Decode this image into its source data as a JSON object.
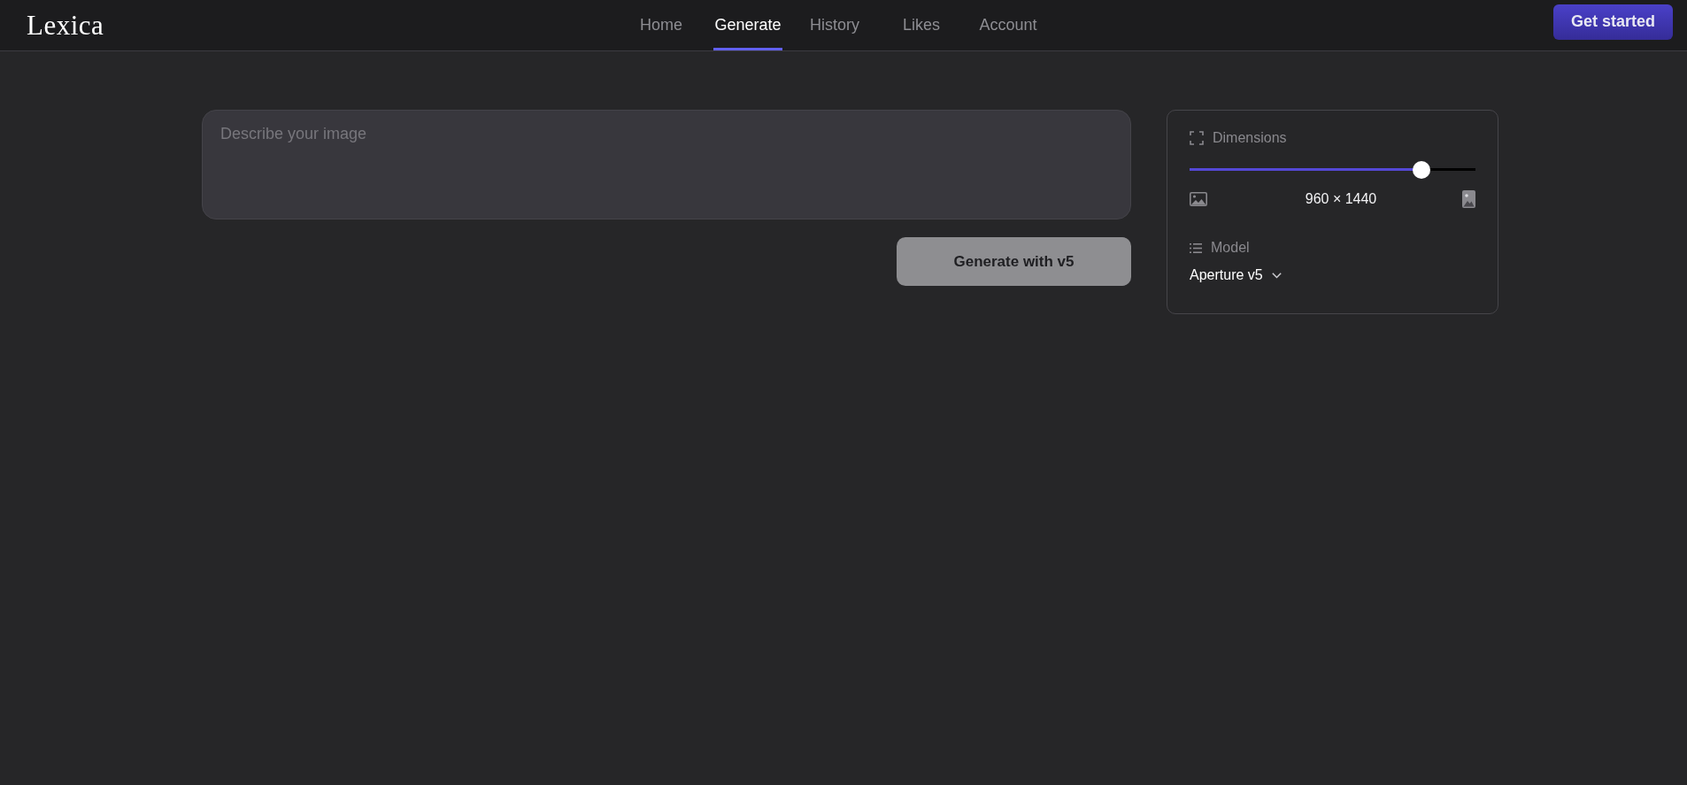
{
  "header": {
    "logo": "Lexica",
    "nav": [
      {
        "label": "Home",
        "selected": false
      },
      {
        "label": "Generate",
        "selected": true
      },
      {
        "label": "History",
        "selected": false
      },
      {
        "label": "Likes",
        "selected": false
      },
      {
        "label": "Account",
        "selected": false
      }
    ],
    "cta": "Get started"
  },
  "prompt": {
    "placeholder": "Describe your image"
  },
  "generate_button": {
    "label": "Generate with v5",
    "disabled": true
  },
  "settings": {
    "dimensions": {
      "label": "Dimensions",
      "level": 0.81,
      "value": "960 × 1440"
    },
    "model": {
      "label": "Model",
      "value": "Aperture v5"
    }
  }
}
